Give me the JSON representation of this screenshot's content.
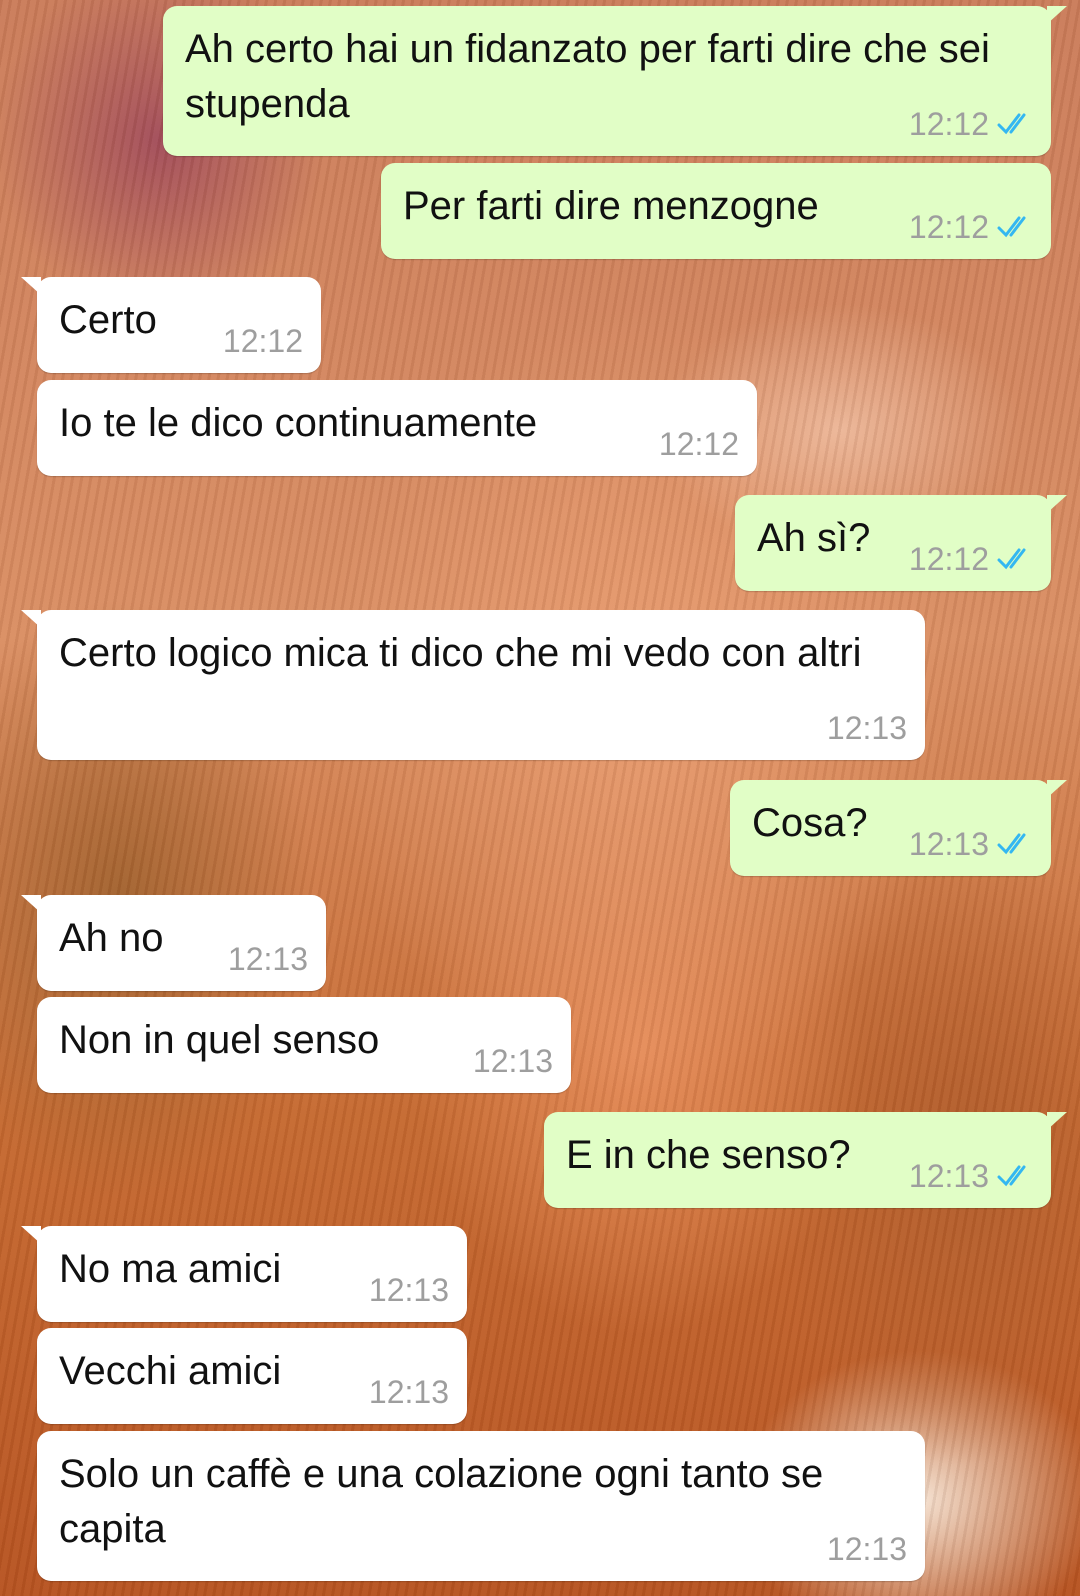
{
  "wallpaper": {
    "description": ""
  },
  "messages": [
    {
      "id": "m1",
      "direction": "outgoing",
      "text": "Ah certo hai un fidanzato per farti dire che sei stupenda",
      "time": "12:12",
      "status": "read"
    },
    {
      "id": "m2",
      "direction": "outgoing",
      "text": "Per farti dire menzogne",
      "time": "12:12",
      "status": "read"
    },
    {
      "id": "m3",
      "direction": "incoming",
      "text": "Certo",
      "time": "12:12"
    },
    {
      "id": "m4",
      "direction": "incoming",
      "text": "Io te le dico continuamente",
      "time": "12:12"
    },
    {
      "id": "m5",
      "direction": "outgoing",
      "text": "Ah sì?",
      "time": "12:12",
      "status": "read"
    },
    {
      "id": "m6",
      "direction": "incoming",
      "text": "Certo logico mica ti dico che mi vedo con altri",
      "time": "12:13"
    },
    {
      "id": "m7",
      "direction": "outgoing",
      "text": "Cosa?",
      "time": "12:13",
      "status": "read"
    },
    {
      "id": "m8",
      "direction": "incoming",
      "text": "Ah no",
      "time": "12:13"
    },
    {
      "id": "m9",
      "direction": "incoming",
      "text": "Non in quel senso",
      "time": "12:13"
    },
    {
      "id": "m10",
      "direction": "outgoing",
      "text": "E in che senso?",
      "time": "12:13",
      "status": "read"
    },
    {
      "id": "m11",
      "direction": "incoming",
      "text": "No ma amici",
      "time": "12:13"
    },
    {
      "id": "m12",
      "direction": "incoming",
      "text": "Vecchi amici",
      "time": "12:13"
    },
    {
      "id": "m13",
      "direction": "incoming",
      "text": "Solo un caffè e una colazione ogni tanto se capita",
      "time": "12:13"
    }
  ],
  "icons": {
    "read_receipt": "double-check-icon"
  },
  "colors": {
    "outgoing_bubble": "#e1fec6",
    "incoming_bubble": "#ffffff",
    "timestamp": "#9e9e9e",
    "read_ticks": "#34b7f1"
  }
}
